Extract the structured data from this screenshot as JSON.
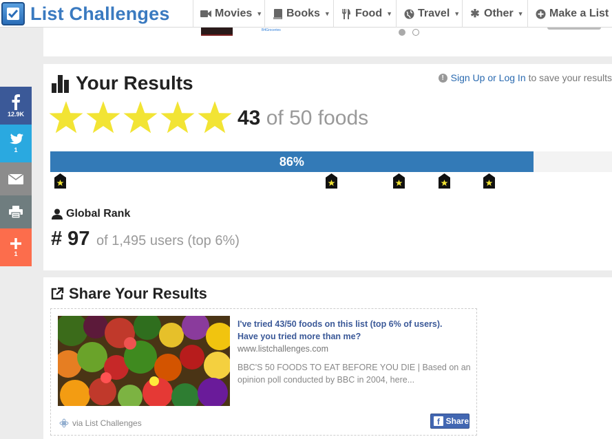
{
  "header": {
    "logo_text": "List Challenges",
    "nav": [
      {
        "label": "Movies",
        "icon": "video-camera-icon"
      },
      {
        "label": "Books",
        "icon": "book-icon"
      },
      {
        "label": "Food",
        "icon": "cutlery-icon"
      },
      {
        "label": "Travel",
        "icon": "globe-icon"
      },
      {
        "label": "Other",
        "icon": "asterisk-icon"
      },
      {
        "label": "Make a List",
        "icon": "plus-circle-icon"
      }
    ]
  },
  "banner": {
    "thumb2_text": "B4Groceries"
  },
  "results": {
    "title": "Your Results",
    "signup_link": "Sign Up or Log In",
    "signup_suffix": "to save your results",
    "stars_filled": 5,
    "stars_total": 5,
    "score_num": "43",
    "score_rest": "of 50 foods",
    "progress_percent": 86,
    "progress_label": "86%",
    "marker_count": 5,
    "rank_label": "Global Rank",
    "rank_num": "# 97",
    "rank_rest": "of 1,495 users (top 6%)"
  },
  "share": {
    "title": "Share Your Results",
    "headline": "I've tried 43/50 foods on this list (top 6% of users). Have you tried more than me?",
    "domain": "www.listchallenges.com",
    "description": "BBC'S 50 FOODS TO EAT BEFORE YOU DIE | Based on an opinion poll conducted by BBC in 2004, here...",
    "via": "via List Challenges",
    "button": "Share"
  },
  "social": {
    "facebook_count": "12.9K",
    "twitter_count": "1",
    "plus_count": "1"
  },
  "colors": {
    "brand": "#3a7ac0",
    "progress": "#337ab7",
    "star": "#f2e434",
    "facebook": "#3b5998",
    "twitter": "#2aa9e0",
    "plus": "#fc6d4c"
  }
}
